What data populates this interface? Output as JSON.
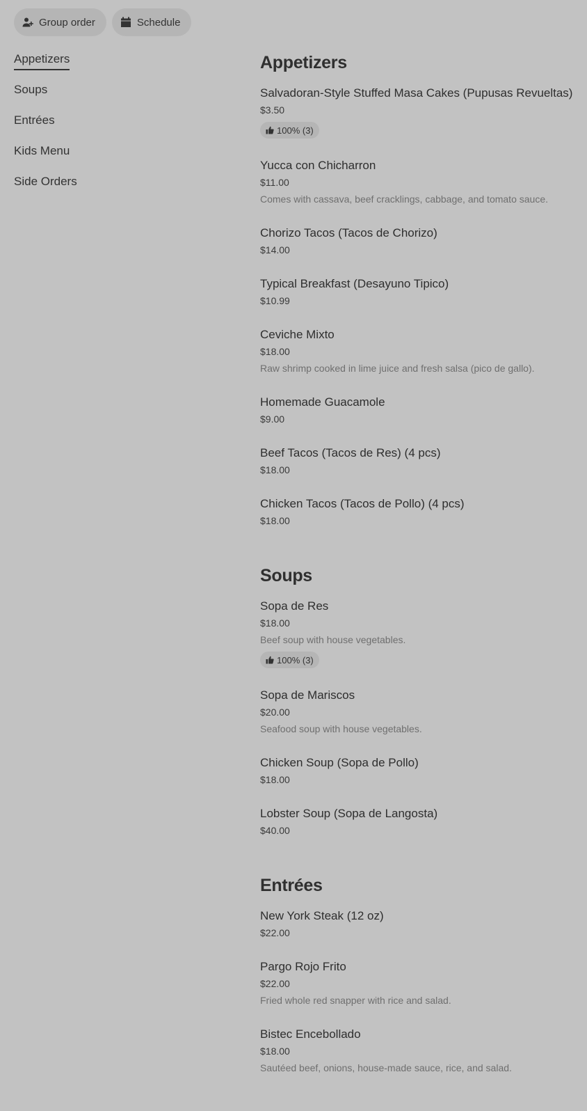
{
  "toolbar": {
    "group_order_label": "Group order",
    "schedule_label": "Schedule"
  },
  "sidebar": {
    "items": [
      {
        "label": "Appetizers"
      },
      {
        "label": "Soups"
      },
      {
        "label": "Entrées"
      },
      {
        "label": "Kids Menu"
      },
      {
        "label": "Side Orders"
      }
    ]
  },
  "sections": [
    {
      "title": "Appetizers",
      "items": [
        {
          "name": "Salvadoran-Style Stuffed Masa Cakes (Pupusas Revueltas)",
          "price": "$3.50",
          "rating": "100% (3)"
        },
        {
          "name": "Yucca con Chicharron",
          "price": "$11.00",
          "desc": "Comes with cassava, beef cracklings, cabbage, and tomato sauce."
        },
        {
          "name": "Chorizo Tacos (Tacos de Chorizo)",
          "price": "$14.00"
        },
        {
          "name": "Typical Breakfast (Desayuno Tipico)",
          "price": "$10.99"
        },
        {
          "name": "Ceviche Mixto",
          "price": "$18.00",
          "desc": "Raw shrimp cooked in lime juice and fresh salsa (pico de gallo)."
        },
        {
          "name": "Homemade Guacamole",
          "price": "$9.00"
        },
        {
          "name": "Beef Tacos (Tacos de Res) (4 pcs)",
          "price": "$18.00"
        },
        {
          "name": "Chicken Tacos (Tacos de Pollo) (4 pcs)",
          "price": "$18.00"
        }
      ]
    },
    {
      "title": "Soups",
      "items": [
        {
          "name": "Sopa de Res",
          "price": "$18.00",
          "desc": "Beef soup with house vegetables.",
          "rating": "100% (3)"
        },
        {
          "name": "Sopa de Mariscos",
          "price": "$20.00",
          "desc": "Seafood soup with house vegetables."
        },
        {
          "name": "Chicken Soup (Sopa de Pollo)",
          "price": "$18.00"
        },
        {
          "name": "Lobster Soup (Sopa de Langosta)",
          "price": "$40.00"
        }
      ]
    },
    {
      "title": "Entrées",
      "items": [
        {
          "name": "New York Steak (12 oz)",
          "price": "$22.00"
        },
        {
          "name": "Pargo Rojo Frito",
          "price": "$22.00",
          "desc": "Fried whole red snapper with rice and salad."
        },
        {
          "name": "Bistec Encebollado",
          "price": "$18.00",
          "desc": "Sautéed beef, onions, house-made sauce, rice, and salad."
        }
      ]
    }
  ]
}
